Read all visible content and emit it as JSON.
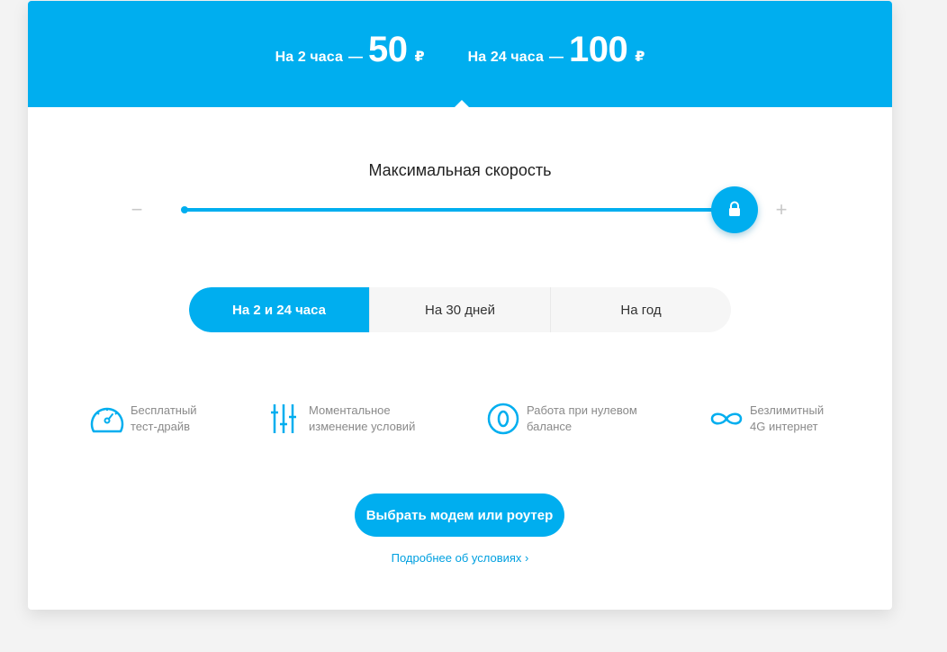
{
  "header": {
    "prices": [
      {
        "label": "На 2 часа",
        "dash": "—",
        "value": "50",
        "currency": "₽"
      },
      {
        "label": "На 24 часа",
        "dash": "—",
        "value": "100",
        "currency": "₽"
      }
    ]
  },
  "speed": {
    "title": "Максимальная скорость",
    "minus": "−",
    "plus": "+",
    "level_fraction": 1.0
  },
  "tabs": [
    {
      "label": "На 2 и 24 часа",
      "active": true
    },
    {
      "label": "На 30 дней",
      "active": false
    },
    {
      "label": "На год",
      "active": false
    }
  ],
  "features": [
    {
      "icon": "speedometer-icon",
      "line1": "Бесплатный",
      "line2": "тест-драйв"
    },
    {
      "icon": "sliders-icon",
      "line1": "Моментальное",
      "line2": "изменение условий"
    },
    {
      "icon": "zero-balance-icon",
      "line1": "Работа при нулевом",
      "line2": "балансе"
    },
    {
      "icon": "infinity-icon",
      "line1": "Безлимитный",
      "line2": "4G интернет"
    }
  ],
  "cta": {
    "label": "Выбрать модем или роутер"
  },
  "details": {
    "label": "Подробнее об условиях ›"
  },
  "colors": {
    "accent": "#00aeef",
    "muted_text": "#8a8a8a",
    "tab_bg": "#f6f6f6"
  }
}
